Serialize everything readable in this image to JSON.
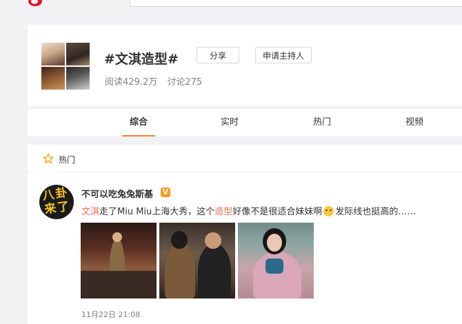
{
  "header": {
    "search_placeholder": ""
  },
  "topic": {
    "title": "#文淇造型#",
    "share_label": "分享",
    "host_label": "申请主持人",
    "reads": "阅读429.2万",
    "discussions": "讨论275"
  },
  "tabs": [
    {
      "label": "综合",
      "active": true
    },
    {
      "label": "实时",
      "active": false
    },
    {
      "label": "热门",
      "active": false
    },
    {
      "label": "视频",
      "active": false
    }
  ],
  "feed": {
    "section_label": "热门",
    "post": {
      "avatar_text": "八卦来了",
      "username": "不可以吃兔兔斯基",
      "badge": "V",
      "text_parts": {
        "link1": "文淇",
        "part1": "走了Miu Miu上海大秀，这个",
        "link2": "造型",
        "part2": "好像不是很适合妹妹啊",
        "part3": "发际线也挺高的……"
      },
      "timestamp": "11月22日 21:08"
    }
  },
  "icons": [
    "weibo-logo-icon",
    "star-icon",
    "verified-badge-icon",
    "emoji-icon"
  ],
  "colors": {
    "accent": "#fa7d3c",
    "link": "#eb7350",
    "badge": "#f79b1c"
  }
}
